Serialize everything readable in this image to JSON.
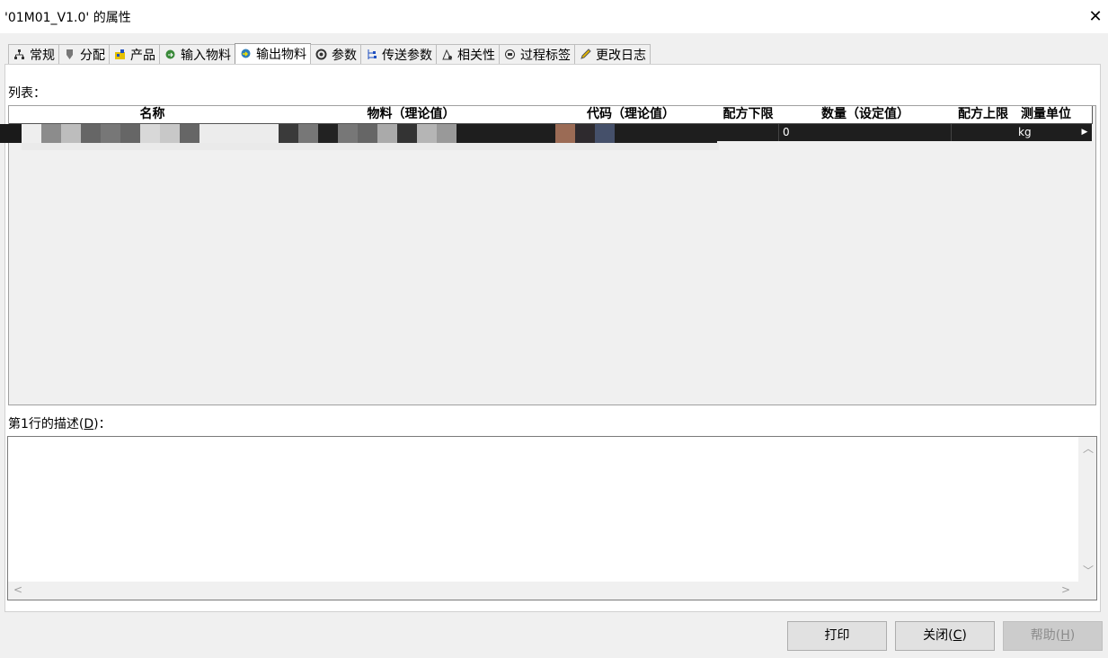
{
  "window": {
    "title": "'01M01_V1.0' 的属性",
    "close_glyph": "✕"
  },
  "tabs": [
    {
      "label": "常规",
      "icon": "sitemap-icon"
    },
    {
      "label": "分配",
      "icon": "shield-icon"
    },
    {
      "label": "产品",
      "icon": "product-icon"
    },
    {
      "label": "输入物料",
      "icon": "input-material-icon"
    },
    {
      "label": "输出物料",
      "icon": "output-material-icon",
      "active": true
    },
    {
      "label": "参数",
      "icon": "parameter-icon"
    },
    {
      "label": "传送参数",
      "icon": "transfer-icon"
    },
    {
      "label": "相关性",
      "icon": "dependency-icon"
    },
    {
      "label": "过程标签",
      "icon": "tag-icon"
    },
    {
      "label": "更改日志",
      "icon": "pencil-icon"
    }
  ],
  "list": {
    "label": "列表：",
    "columns": [
      "名称",
      "物料（理论值）",
      "代码（理论值）",
      "配方下限",
      "数量（设定值）",
      "配方上限",
      "测量单位"
    ],
    "rows": [
      {
        "quantity": "0",
        "unit": "kg"
      }
    ]
  },
  "description": {
    "label_prefix": "第1行的描述(",
    "label_key": "D",
    "label_suffix": ")：",
    "value": ""
  },
  "buttons": {
    "print": "打印",
    "close_prefix": "关闭(",
    "close_key": "C",
    "close_suffix": ")",
    "help_prefix": "帮助(",
    "help_key": "H",
    "help_suffix": ")"
  },
  "colors": {
    "selection": "#1e1e1e",
    "header_bg": "#ffffff",
    "dialog_bg": "#f0f0f0"
  }
}
